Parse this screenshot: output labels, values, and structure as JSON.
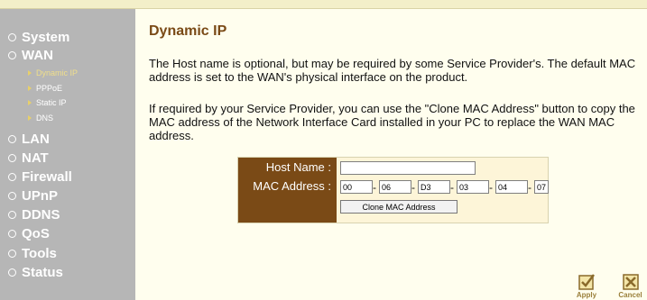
{
  "sidebar": {
    "items": [
      {
        "label": "System"
      },
      {
        "label": "WAN"
      },
      {
        "label": "LAN"
      },
      {
        "label": "NAT"
      },
      {
        "label": "Firewall"
      },
      {
        "label": "UPnP"
      },
      {
        "label": "DDNS"
      },
      {
        "label": "QoS"
      },
      {
        "label": "Tools"
      },
      {
        "label": "Status"
      }
    ],
    "wan_subitems": [
      {
        "label": "Dynamic IP",
        "active": true
      },
      {
        "label": "PPPoE",
        "active": false
      },
      {
        "label": "Static IP",
        "active": false
      },
      {
        "label": "DNS",
        "active": false
      }
    ]
  },
  "main": {
    "title": "Dynamic IP",
    "para1": "The Host name is optional, but may be required by some Service Provider's. The default MAC address is set to the WAN's physical interface on the product.",
    "para2": "If required by your Service Provider, you can use the \"Clone MAC Address\" button to copy the MAC address of the Network Interface Card installed in your PC to replace the WAN MAC address."
  },
  "form": {
    "host_label": "Host Name :",
    "host_value": "",
    "mac_label": "MAC Address :",
    "mac_octets": [
      "00",
      "06",
      "D3",
      "03",
      "04",
      "07"
    ],
    "mac_separator": "-",
    "clone_button": "Clone MAC Address"
  },
  "actions": {
    "apply_label": "Apply",
    "cancel_label": "Cancel"
  },
  "colors": {
    "sidebar_bg": "#b6b6b6",
    "title_brown": "#7a4a16",
    "content_bg": "#fffeee"
  },
  "icons": {
    "nav_bullet": "circle-bullet-icon",
    "sub_bullet": "triangle-bullet-icon",
    "apply": "apply-checkmark-icon",
    "cancel": "cancel-x-icon"
  }
}
